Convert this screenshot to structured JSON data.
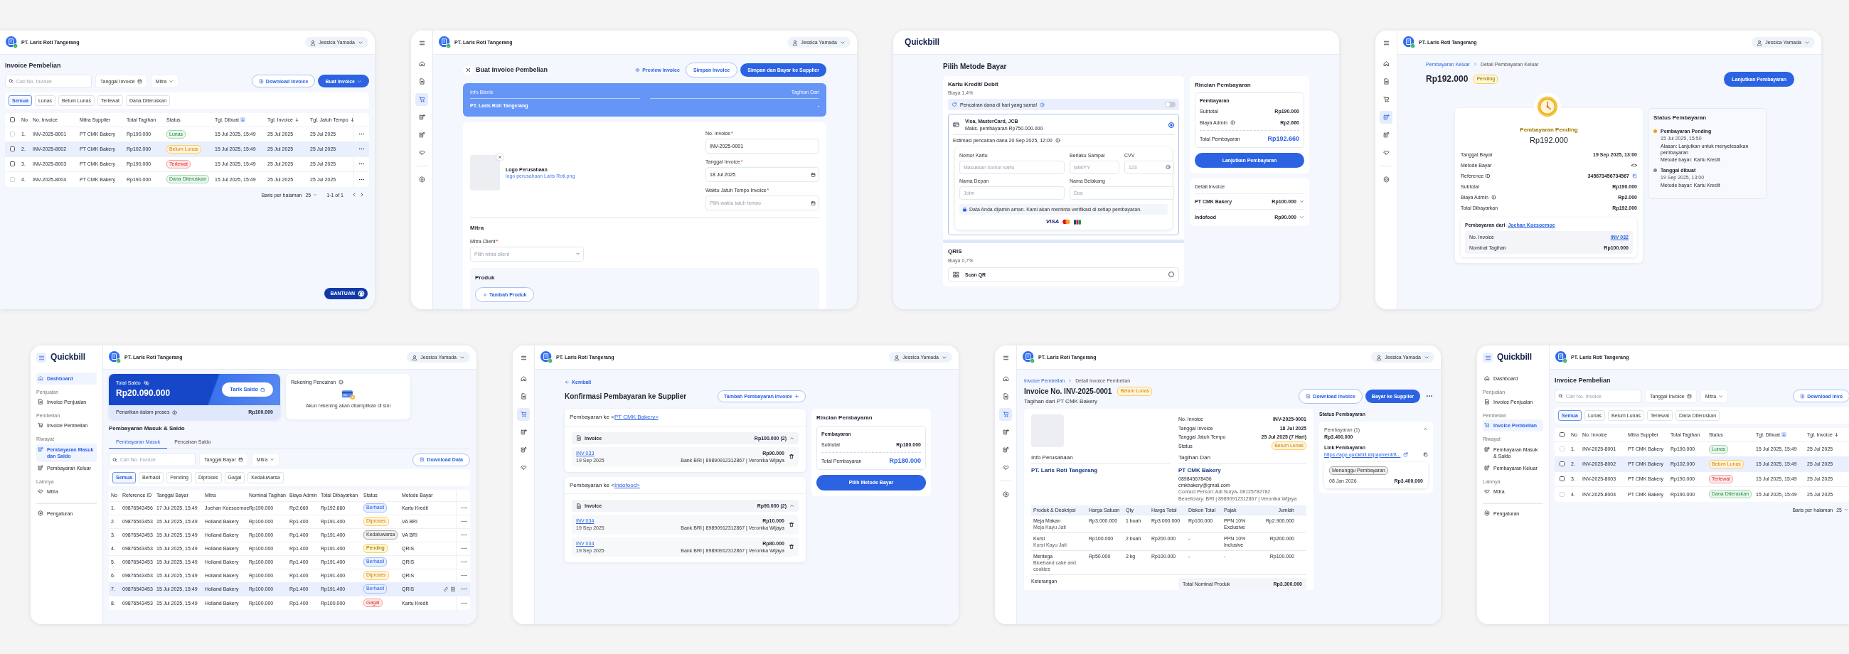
{
  "screens": [
    {
      "kind": "invoice_list",
      "header": {
        "company": "PT. Laris Roti Tangerang",
        "user": "Jessica Yamada"
      },
      "title": "Invoice Pembelian",
      "search": {
        "placeholder": "Cari No. Invoice"
      },
      "filters": [
        {
          "label": "Tanggal Invoice",
          "kind": "date"
        },
        {
          "label": "Mitra",
          "kind": "dropdown"
        }
      ],
      "actions": [
        {
          "label": "Download Invoice",
          "kind": "outline"
        },
        {
          "label": "Buat Invoice",
          "kind": "primary"
        }
      ],
      "chips": [
        {
          "label": "Semua",
          "selected": true
        },
        {
          "label": "Lunas",
          "selected": false
        },
        {
          "label": "Belum Lunas",
          "selected": false
        },
        {
          "label": "Terlewat",
          "selected": false
        },
        {
          "label": "Dana Diteruskan",
          "selected": false
        }
      ],
      "table": {
        "select_all": false,
        "row_actions": true,
        "columns": [
          {
            "label": "No"
          },
          {
            "label": "No. Invoice"
          },
          {
            "label": "Mitra Supplier"
          },
          {
            "label": "Total Tagihan"
          },
          {
            "label": "Status"
          },
          {
            "label": "Tgl. Dibuat",
            "sortable": true,
            "sort_active": true
          },
          {
            "label": "Tgl. Invoice",
            "sortable": true,
            "sort_active": false
          },
          {
            "label": "Tgl. Jatuh Tempo",
            "sortable": true,
            "sort_active": false
          }
        ],
        "rows": [
          {
            "checked": false,
            "disabled": true,
            "selected": false,
            "cells": [
              "1.",
              "INV-2025-8001",
              "PT CMK Bakery",
              "Rp190.000",
              {
                "text": "Lunas",
                "kind": "success"
              },
              "15 Jul 2025, 15:49",
              "25 Jul 2025",
              "25 Jul 2025"
            ]
          },
          {
            "checked": false,
            "disabled": false,
            "selected": true,
            "cells": [
              "2.",
              "INV-2025-8002",
              "PT CMK Bakery",
              "Rp102.000",
              {
                "text": "Belum Lunas",
                "kind": "warning"
              },
              "15 Jul 2025, 15:49",
              "25 Jul 2025",
              "25 Jul 2025"
            ]
          },
          {
            "checked": false,
            "disabled": false,
            "selected": false,
            "cells": [
              "3.",
              "INV-2025-8003",
              "PT CMK Bakery",
              "Rp190.000",
              {
                "text": "Terlewat",
                "kind": "danger"
              },
              "15 Jul 2025, 15:49",
              "25 Jul 2025",
              "25 Jul 2025"
            ]
          },
          {
            "checked": false,
            "disabled": true,
            "selected": false,
            "cells": [
              "4.",
              "INV-2025-8004",
              "PT CMK Bakery",
              "Rp190.000",
              {
                "text": "Dana Diteruskan",
                "kind": "success"
              },
              "15 Jul 2025, 15:49",
              "25 Jul 2025",
              "25 Jul 2025"
            ]
          }
        ]
      },
      "pagination": {
        "label": "Baris per halaman",
        "size": "25",
        "range": "1-1 of 1"
      },
      "help": "BANTUAN"
    },
    {
      "kind": "create_invoice",
      "nav": {
        "kind": "rail",
        "items": [
          {
            "selected": false
          },
          {
            "selected": false
          },
          {
            "selected": true
          },
          {
            "selected": false
          },
          {
            "selected": false
          },
          {
            "selected": false
          },
          {
            "selected": false
          }
        ]
      },
      "header": {
        "company": "PT. Laris Roti Tangerang",
        "user": "Jessica Yamada"
      },
      "title": "Buat Invoice Pembelian",
      "preview": "Preview Invoice",
      "actions": [
        {
          "label": "Simpan Invoice",
          "kind": "outline"
        },
        {
          "label": "Simpan dan Bayar ke Supplier",
          "kind": "primary"
        }
      ],
      "banner": {
        "left_label": "Info Bisnis",
        "left_value": "PT. Laris Roti Tangerang",
        "right_label": "Tagihan Dari",
        "right_value": "-"
      },
      "logo": {
        "title": "Logo Perusahaan",
        "file": "logo perusahaan Laris Roti.png"
      },
      "fields": [
        {
          "label": "No. Invoice",
          "required_mark": "*",
          "value": "INV-2025-0001",
          "kind": "text"
        },
        {
          "label": "Tanggal Invoice",
          "required_mark": "*",
          "value": "18 Jul 2025",
          "kind": "date"
        },
        {
          "label": "Waktu Jatuh Tempo Invoice",
          "required_mark": "*",
          "placeholder": "Pilih waktu jatuh tempo",
          "kind": "date"
        }
      ],
      "partner": {
        "heading": "Mitra",
        "field": {
          "label": "Mitra Client",
          "required_mark": "*",
          "placeholder": "Pilih mitra client"
        }
      },
      "products": {
        "heading": "Produk",
        "button": "Tambah Produk"
      }
    },
    {
      "kind": "payment_method",
      "header": {
        "logo": "Quickbill"
      },
      "title": "Pilih Metode Bayar",
      "methods": [
        {
          "name": "Kartu Kredit/ Debit",
          "fee": "Biaya 1,4%",
          "instant": {
            "text": "Pencairan dana di hari yang sama!",
            "on": false
          },
          "option": {
            "title": "Visa, MasterCard, JCB",
            "limit": "Maks. pembayaran Rp750.000.000",
            "selected": true,
            "estimate": "Estimasi pencairan dana 20 Sep 2025, 12:00",
            "fields": [
              {
                "label": "Nomor Kartu",
                "placeholder": "Masukkan nomor kartu"
              },
              {
                "label": "Berlaku Sampai",
                "placeholder": "MM/YY"
              },
              {
                "label": "CVV",
                "placeholder": "123"
              },
              {
                "label": "Nama Depan",
                "placeholder": "John"
              },
              {
                "label": "Nama Belakang",
                "placeholder": "Doe"
              }
            ],
            "notice": "Data Anda dijamin aman. Kami akan meminta verifikasi di setiap pembayaran.",
            "brand": "VISA"
          }
        },
        {
          "name": "QRIS",
          "fee": "Biaya 0,7%",
          "option": {
            "title": "Scan QR",
            "selected": false
          }
        }
      ],
      "summary": {
        "title": "Rincian Pembayaran",
        "heading": "Pembayaran",
        "lines": [
          {
            "label": "Subtotal",
            "value": "Rp190.000"
          },
          {
            "label": "Biaya Admin",
            "value": "Rp2.660",
            "info": true
          }
        ],
        "total_label": "Total Pembayaran",
        "total": "Rp192.660",
        "button": "Lanjutkan Pembayaran"
      },
      "invoice_detail": {
        "title": "Detail Invoice",
        "items": [
          {
            "name": "PT CMK Bakery",
            "amount": "Rp100.000",
            "expanded": false
          },
          {
            "name": "Indofood",
            "amount": "Rp90.000",
            "expanded": false
          }
        ]
      }
    },
    {
      "kind": "payment_detail",
      "nav": {
        "kind": "rail",
        "items": [
          {
            "selected": false
          },
          {
            "selected": false
          },
          {
            "selected": false
          },
          {
            "selected": true
          },
          {
            "selected": false
          },
          {
            "selected": false
          },
          {
            "selected": false
          }
        ]
      },
      "header": {
        "company": "PT. Laris Roti Tangerang",
        "user": "Jessica Yamada"
      },
      "breadcrumb": [
        {
          "label": "Pembayaran Keluar"
        },
        {
          "label": "Detail Pembayaran Keluar"
        }
      ],
      "amount": "Rp192.000",
      "badge": {
        "text": "Pending",
        "kind": "pending"
      },
      "button": "Lanjutkan Pembayaran",
      "receipt": {
        "status": "Pembayaran Pending",
        "amount": "Rp192.000",
        "rows": [
          {
            "label": "Tanggal Bayar",
            "value": "19 Sep 2025, 13:00"
          },
          {
            "label": "Metode Bayar",
            "value": "<>"
          },
          {
            "label": "Reference ID",
            "value": "345673456734567",
            "copy": true
          },
          {
            "label": "Subtotal",
            "value": "Rp190.000"
          },
          {
            "label": "Biaya Admin",
            "value": "Rp2.000",
            "info": true
          },
          {
            "label": "Total Dibayarkan",
            "value": "Rp192.000"
          }
        ],
        "source": {
          "prefix": "Pembayaran dari",
          "name": "Joehan Koesoemoe",
          "rows": [
            {
              "label": "No. Invoice",
              "value": "INV 032",
              "link": true
            },
            {
              "label": "Nominal Tagihan",
              "value": "Rp100.000"
            }
          ]
        }
      },
      "timeline": {
        "title": "Status Pembayaran",
        "events": [
          {
            "title": "Pembayaran Pending",
            "color": "#f59e0b",
            "lines": [
              "15 Jul 2025, 15:50",
              "Alasan: Lanjutkan untuk menyelesaikan pembayaran",
              "Metode bayar: Kartu Kredit"
            ]
          },
          {
            "title": "Tanggal dibuat",
            "color": "#8a8a8a",
            "lines": [
              "19 Sep 2025, 13:00",
              "Metode bayar: Kartu Kredit"
            ]
          }
        ]
      }
    },
    {
      "kind": "dashboard",
      "nav": {
        "kind": "sidebar",
        "logo": "Quickbill",
        "sections": [
          {
            "items": [
              {
                "label": "Dashboard",
                "selected": true
              }
            ]
          },
          {
            "heading": "Penjualan",
            "items": [
              {
                "label": "Invoice Penjualan",
                "selected": false
              }
            ]
          },
          {
            "heading": "Pembelian",
            "items": [
              {
                "label": "Invoice Pembelian",
                "selected": false
              }
            ]
          },
          {
            "heading": "Riwayat",
            "items": [
              {
                "label": "Pembayaran Masuk dan Saldo",
                "selected": true
              },
              {
                "label": "Pembayaran Keluar",
                "selected": false
              }
            ]
          },
          {
            "heading": "Lainnya",
            "items": [
              {
                "label": "Mitra",
                "selected": false
              }
            ]
          },
          {
            "separated": true,
            "items": [
              {
                "label": "Pengaturan",
                "selected": false
              }
            ]
          }
        ]
      },
      "header": {
        "company": "PT. Laris Roti Tangerang",
        "user": "Jessica Yamada"
      },
      "balance": {
        "label": "Total Saldo",
        "amount": "Rp20.090.000",
        "button": "Tarik Saldo",
        "pending_label": "Penarikan dalam proses",
        "pending_amount": "Rp100.000"
      },
      "account": {
        "title": "Rekening Pencairan",
        "empty_text": "Akun rekening akan ditampilkan di sini"
      },
      "section_title": "Pembayaran Masuk & Saldo",
      "tabs": [
        {
          "label": "Pembayaran Masuk",
          "selected": true
        },
        {
          "label": "Pencairan Saldo",
          "selected": false
        }
      ],
      "search": {
        "placeholder": "Cari No. Invoice"
      },
      "filters": [
        {
          "label": "Tanggal Bayar",
          "kind": "date"
        },
        {
          "label": "Mitra",
          "kind": "dropdown"
        }
      ],
      "actions": [
        {
          "label": "Download Data",
          "kind": "outline"
        }
      ],
      "chips": [
        {
          "label": "Semua",
          "selected": true
        },
        {
          "label": "Berhasil",
          "selected": false
        },
        {
          "label": "Pending",
          "selected": false
        },
        {
          "label": "Diproses",
          "selected": false
        },
        {
          "label": "Gagal",
          "selected": false
        },
        {
          "label": "Kedaluwarsa",
          "selected": false
        }
      ],
      "table": {
        "row_actions": true,
        "row_hover_icons": true,
        "columns": [
          {
            "label": "No"
          },
          {
            "label": "Reference ID"
          },
          {
            "label": "Tanggal Bayar"
          },
          {
            "label": "Mitra"
          },
          {
            "label": "Nominal Tagihan"
          },
          {
            "label": "Biaya Admin"
          },
          {
            "label": "Total Dibayarkan"
          },
          {
            "label": "Status"
          },
          {
            "label": "Metode Bayar"
          }
        ],
        "rows": [
          {
            "selected": false,
            "cells": [
              "1.",
              "09876543456",
              "17 Jul 2025, 15:49",
              "Joehan Koesoemoe",
              "Rp190.000",
              "Rp2.660",
              "Rp192.660",
              {
                "text": "Berhasil",
                "kind": "info"
              },
              "Kartu Kredit"
            ]
          },
          {
            "selected": false,
            "cells": [
              "2.",
              "09876543453",
              "15 Jul 2025, 15:49",
              "Holland Bakery",
              "Rp100.000",
              "Rp1.400",
              "Rp191.400",
              {
                "text": "Diproses",
                "kind": "warning"
              },
              "VA BRI"
            ]
          },
          {
            "selected": false,
            "cells": [
              "3.",
              "09876543453",
              "15 Jul 2025, 15:49",
              "Holland Bakery",
              "Rp100.000",
              "Rp1.400",
              "Rp191.400",
              {
                "text": "Kedaluwarsa",
                "kind": "neutral"
              },
              "VA BRI"
            ]
          },
          {
            "selected": false,
            "cells": [
              "4.",
              "09876543453",
              "15 Jul 2025, 15:49",
              "Holland Bakery",
              "Rp100.000",
              "Rp1.400",
              "Rp191.400",
              {
                "text": "Pending",
                "kind": "pending"
              },
              "QRIS"
            ]
          },
          {
            "selected": false,
            "cells": [
              "5.",
              "09876543453",
              "15 Jul 2025, 15:49",
              "Holland Bakery",
              "Rp100.000",
              "Rp1.400",
              "Rp191.400",
              {
                "text": "Berhasil",
                "kind": "info"
              },
              "QRIS"
            ]
          },
          {
            "selected": false,
            "cells": [
              "6.",
              "09876543453",
              "15 Jul 2025, 15:49",
              "Holland Bakery",
              "Rp100.000",
              "Rp1.400",
              "Rp191.400",
              {
                "text": "Diproses",
                "kind": "warning"
              },
              "QRIS"
            ]
          },
          {
            "selected": true,
            "cells": [
              "7.",
              "09876543453",
              "15 Jul 2025, 15:49",
              "Holland Bakery",
              "Rp100.000",
              "Rp1.400",
              "Rp191.400",
              {
                "text": "Berhasil",
                "kind": "info"
              },
              "QRIS"
            ]
          },
          {
            "selected": false,
            "cells": [
              "8.",
              "09876543453",
              "15 Jul 2025, 15:49",
              "Holland Bakery",
              "Rp100.000",
              "Rp1.400",
              "Rp100.000",
              {
                "text": "Gagal",
                "kind": "danger"
              },
              "Kartu Kredit"
            ]
          }
        ]
      }
    },
    {
      "kind": "confirm_payment",
      "nav": {
        "kind": "rail",
        "items": [
          {
            "selected": false
          },
          {
            "selected": false
          },
          {
            "selected": true
          },
          {
            "selected": false
          },
          {
            "selected": false
          },
          {
            "selected": false
          }
        ]
      },
      "header": {
        "company": "PT. Laris Roti Tangerang",
        "user": "Jessica Yamada"
      },
      "back": "Kembali",
      "title": "Konfirmasi Pembayaran ke Supplier",
      "add_button": "Tambah Pembayaran Invoice",
      "groups": [
        {
          "prefix": "Pembayaran ke <",
          "supplier": "PT CMK Bakery>",
          "section": "Invoice",
          "total": "Rp100.000 (2)",
          "expanded": true,
          "items": [
            {
              "invoice": "INV 033",
              "date": "19 Sep 2025",
              "amount": "Rp90.000",
              "account": "Bank BRI | 89890912312867 | Veronika Wijaya"
            }
          ]
        },
        {
          "prefix": "Pembayaran ke <",
          "supplier": "Indofood>",
          "section": "Invoice",
          "total": "Rp90.000 (2)",
          "expanded": true,
          "items": [
            {
              "invoice": "INV 034",
              "date": "19 Sep 2025",
              "amount": "Rp10.000",
              "account": "Bank BRI | 89890912312867 | Veronika Wijaya"
            },
            {
              "invoice": "INV 034",
              "date": "19 Sep 2025",
              "amount": "Rp80.000",
              "account": "Bank BRI | 89890912312867 | Veronika Wijaya"
            }
          ]
        }
      ],
      "summary": {
        "title": "Rincian Pembayaran",
        "heading": "Pembayaran",
        "lines": [
          {
            "label": "Subtotal",
            "value": "Rp180.000"
          }
        ],
        "total_label": "Total Pembayaran",
        "total": "Rp180.000",
        "button": "Pilih Metode Bayar"
      }
    },
    {
      "kind": "invoice_detail",
      "nav": {
        "kind": "rail",
        "items": [
          {
            "selected": false
          },
          {
            "selected": false
          },
          {
            "selected": true
          },
          {
            "selected": false
          },
          {
            "selected": false
          },
          {
            "selected": false
          },
          {
            "selected": false
          }
        ]
      },
      "header": {
        "company": "PT. Laris Roti Tangerang",
        "user": "Jessica Yamada"
      },
      "breadcrumb": [
        {
          "label": "Invoice Pembelian"
        },
        {
          "label": "Detail Invoice Pembelian"
        }
      ],
      "title": "Invoice No. INV-2025-0001",
      "badge": {
        "text": "Belum Lunas",
        "kind": "warning"
      },
      "subtitle": "Tagihan dari PT CMK Bakery",
      "actions": [
        {
          "label": "Download Invoice",
          "kind": "outline"
        },
        {
          "label": "Bayar ke Supplier",
          "kind": "primary"
        }
      ],
      "document": {
        "meta": [
          {
            "label": "No. Invoice",
            "value": "INV-2025-0001"
          },
          {
            "label": "Tanggal Invoice",
            "value": "18 Jul 2025"
          },
          {
            "label": "Tanggal Jatuh Tempo",
            "value": "25 Jul 2025 (7 Hari)"
          },
          {
            "label": "Status",
            "badge": {
              "text": "Belum Lunas",
              "kind": "warning"
            }
          }
        ],
        "company": {
          "heading": "Info Perusahaan",
          "name": "PT. Laris Roti Tangerang"
        },
        "billed_from": {
          "heading": "Tagihan Dari",
          "name": "PT CMK Bakery",
          "lines": [
            "089845678456",
            "cmkbakery@gmail.com"
          ],
          "notes": [
            "Contact Person: Adi Surya- 08125782782",
            "Beneficiary: BRI | 89890912312867 | Veronika Wijaya"
          ]
        },
        "table": {
          "columns": [
            "Produk & Deskripsi",
            "Harga Satuan",
            "Qty",
            "Harga Total",
            "Diskon Total",
            "Pajak",
            "Jumlah"
          ],
          "rows": [
            {
              "cells": [
                {
                  "text": "Meja Makan",
                  "description": "Meja Kayu Jati"
                },
                "Rp3.000.000",
                "1 buah",
                "Rp3.000.000",
                "Rp100.000",
                "PPN 10% Exclusive",
                "Rp2.900.000"
              ]
            },
            {
              "cells": [
                {
                  "text": "Kursi",
                  "description": "Kursi Kayu Jati"
                },
                "Rp100.000",
                "2 buah",
                "Rp200.000",
                "-",
                "PPN 10% Inclusive",
                "Rp200.000"
              ]
            },
            {
              "cells": [
                {
                  "text": "Mentega",
                  "description": "Blueband cake and cookies"
                },
                "Rp50.000",
                "2 kg",
                "Rp100.000",
                "-",
                "-",
                "Rp100.000"
              ]
            }
          ]
        },
        "note_label": "Keterangan",
        "total_label": "Total Nominal Produk",
        "total": "Rp3.300.000"
      },
      "payment_status": {
        "title": "Status Pembayaran",
        "payment": {
          "label": "Pembayaran (1)",
          "amount": "Rp3.400.000",
          "expanded": true,
          "link_label": "Link Pembayaran",
          "link": "https://app.quickbill.id/payment/8...",
          "entry": {
            "badge": {
              "text": "Menunggu Pembayaran",
              "kind": "neutral"
            },
            "date": "08 Jan 2026",
            "amount": "Rp3.400.000"
          }
        }
      }
    },
    {
      "kind": "invoice_list",
      "nav": {
        "kind": "sidebar",
        "logo": "Quickbill",
        "sections": [
          {
            "items": [
              {
                "label": "Dashboard",
                "selected": false
              }
            ]
          },
          {
            "heading": "Penjualan",
            "items": [
              {
                "label": "Invoice Penjualan",
                "selected": false
              }
            ]
          },
          {
            "heading": "Pembelian",
            "items": [
              {
                "label": "Invoice Pembelian",
                "selected": true
              }
            ]
          },
          {
            "heading": "Riwayat",
            "items": [
              {
                "label": "Pembayaran Masuk & Saldo",
                "selected": false
              },
              {
                "label": "Pembayaran Keluar",
                "selected": false
              }
            ]
          },
          {
            "heading": "Lainnya",
            "items": [
              {
                "label": "Mitra",
                "selected": false
              }
            ]
          },
          {
            "separated": true,
            "items": [
              {
                "label": "Pengaturan",
                "selected": false
              }
            ]
          }
        ]
      },
      "header": {
        "company": "PT. Laris Roti Tangerang"
      },
      "title": "Invoice Pembelian",
      "search": {
        "placeholder": "Cari No. Invoice"
      },
      "filters": [
        {
          "label": "Tanggal Invoice",
          "kind": "date"
        },
        {
          "label": "Mitra",
          "kind": "dropdown"
        }
      ],
      "actions": [
        {
          "label": "Download Invo",
          "kind": "outline"
        }
      ],
      "chips": [
        {
          "label": "Semua",
          "selected": true
        },
        {
          "label": "Lunas",
          "selected": false
        },
        {
          "label": "Belum Lunas",
          "selected": false
        },
        {
          "label": "Terlewat",
          "selected": false
        },
        {
          "label": "Dana Diteruskan",
          "selected": false
        }
      ],
      "table": {
        "select_all": false,
        "columns": [
          {
            "label": "No"
          },
          {
            "label": "No. Invoice"
          },
          {
            "label": "Mitra Supplier"
          },
          {
            "label": "Total Tagihan"
          },
          {
            "label": "Status"
          },
          {
            "label": "Tgl. Dibuat",
            "sortable": true,
            "sort_active": true
          },
          {
            "label": "Tgl. Invoice",
            "sortable": true,
            "sort_active": false
          }
        ],
        "rows": [
          {
            "checked": false,
            "disabled": true,
            "selected": false,
            "cells": [
              "1.",
              "INV-2025-8001",
              "PT CMK Bakery",
              "Rp190.000",
              {
                "text": "Lunas",
                "kind": "success"
              },
              "15 Jul 2025, 15:49",
              "25 Jul 2025"
            ]
          },
          {
            "checked": false,
            "disabled": false,
            "selected": true,
            "cells": [
              "2.",
              "INV-2025-8002",
              "PT CMK Bakery",
              "Rp102.000",
              {
                "text": "Belum Lunas",
                "kind": "warning"
              },
              "15 Jul 2025, 15:49",
              "25 Jul 2025"
            ]
          },
          {
            "checked": false,
            "disabled": false,
            "selected": false,
            "cells": [
              "3.",
              "INV-2025-8003",
              "PT CMK Bakery",
              "Rp190.000",
              {
                "text": "Terlewat",
                "kind": "danger"
              },
              "15 Jul 2025, 15:49",
              "25 Jul 2025"
            ]
          },
          {
            "checked": false,
            "disabled": true,
            "selected": false,
            "cells": [
              "4.",
              "INV-2025-8004",
              "PT CMK Bakery",
              "Rp190.000",
              {
                "text": "Dana Diteruskan",
                "kind": "success"
              },
              "15 Jul 2025, 15:49",
              "25 Jul 2025"
            ]
          }
        ]
      },
      "pagination": {
        "label": "Baris per halaman",
        "size": "25"
      }
    }
  ]
}
